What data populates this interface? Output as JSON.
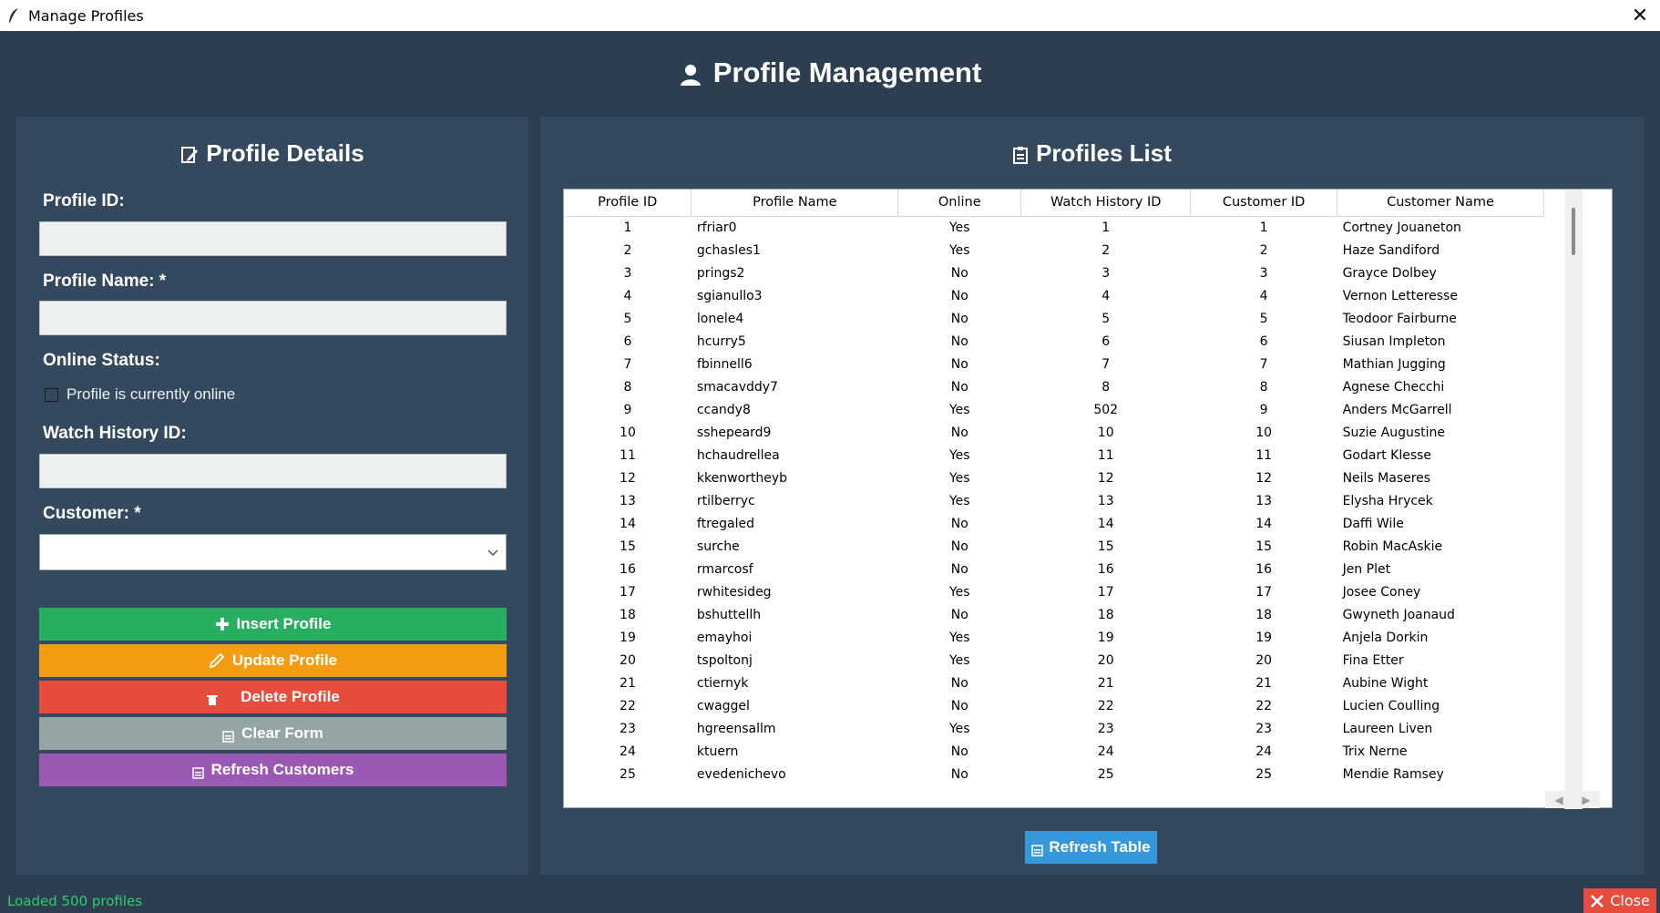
{
  "window": {
    "title": "Manage Profiles",
    "close_glyph": "✕"
  },
  "header": {
    "title": "Profile Management",
    "icon": "user-icon"
  },
  "form": {
    "title": "Profile Details",
    "icon": "edit-icon",
    "profile_id_label": "Profile ID:",
    "profile_id_value": "",
    "profile_name_label": "Profile Name: *",
    "profile_name_value": "",
    "online_status_label": "Online Status:",
    "online_checkbox_label": "Profile is currently online",
    "online_checked": false,
    "watch_history_label": "Watch History ID:",
    "watch_history_value": "",
    "customer_label": "Customer: *",
    "customer_value": "",
    "buttons": {
      "insert": "Insert Profile",
      "update": "Update Profile",
      "delete": "Delete Profile",
      "clear": "Clear Form",
      "refresh_customers": "Refresh Customers"
    }
  },
  "table": {
    "title": "Profiles List",
    "icon": "clipboard-icon",
    "columns": [
      "Profile ID",
      "Profile Name",
      "Online",
      "Watch History ID",
      "Customer ID",
      "Customer Name"
    ],
    "rows": [
      [
        "1",
        "rfriar0",
        "Yes",
        "1",
        "1",
        "Cortney Jouaneton"
      ],
      [
        "2",
        "gchasles1",
        "Yes",
        "2",
        "2",
        "Haze Sandiford"
      ],
      [
        "3",
        "prings2",
        "No",
        "3",
        "3",
        "Grayce Dolbey"
      ],
      [
        "4",
        "sgianullo3",
        "No",
        "4",
        "4",
        "Vernon Letteresse"
      ],
      [
        "5",
        "lonele4",
        "No",
        "5",
        "5",
        "Teodoor Fairburne"
      ],
      [
        "6",
        "hcurry5",
        "No",
        "6",
        "6",
        "Siusan Impleton"
      ],
      [
        "7",
        "fbinnell6",
        "No",
        "7",
        "7",
        "Mathian Jugging"
      ],
      [
        "8",
        "smacavddy7",
        "No",
        "8",
        "8",
        "Agnese Checchi"
      ],
      [
        "9",
        "ccandy8",
        "Yes",
        "502",
        "9",
        "Anders McGarrell"
      ],
      [
        "10",
        "sshepeard9",
        "No",
        "10",
        "10",
        "Suzie Augustine"
      ],
      [
        "11",
        "hchaudrellea",
        "Yes",
        "11",
        "11",
        "Godart Klesse"
      ],
      [
        "12",
        "kkenwortheyb",
        "Yes",
        "12",
        "12",
        "Neils Maseres"
      ],
      [
        "13",
        "rtilberryc",
        "Yes",
        "13",
        "13",
        "Elysha Hrycek"
      ],
      [
        "14",
        "ftregaled",
        "No",
        "14",
        "14",
        "Daffi Wile"
      ],
      [
        "15",
        "surche",
        "No",
        "15",
        "15",
        "Robin MacAskie"
      ],
      [
        "16",
        "rmarcosf",
        "No",
        "16",
        "16",
        "Jen Plet"
      ],
      [
        "17",
        "rwhitesideg",
        "Yes",
        "17",
        "17",
        "Josee Coney"
      ],
      [
        "18",
        "bshuttellh",
        "No",
        "18",
        "18",
        "Gwyneth Joanaud"
      ],
      [
        "19",
        "emayhoi",
        "Yes",
        "19",
        "19",
        "Anjela Dorkin"
      ],
      [
        "20",
        "tspoltonj",
        "Yes",
        "20",
        "20",
        "Fina Etter"
      ],
      [
        "21",
        "ctiernyk",
        "No",
        "21",
        "21",
        "Aubine Wight"
      ],
      [
        "22",
        "cwaggel",
        "No",
        "22",
        "22",
        "Lucien Coulling"
      ],
      [
        "23",
        "hgreensallm",
        "Yes",
        "23",
        "23",
        "Laureen Liven"
      ],
      [
        "24",
        "ktuern",
        "No",
        "24",
        "24",
        "Trix Nerne"
      ],
      [
        "25",
        "evedenichevo",
        "No",
        "25",
        "25",
        "Mendie Ramsey"
      ]
    ],
    "refresh_button": "Refresh Table"
  },
  "status": {
    "text": "Loaded 500 profiles"
  },
  "close_button": "Close"
}
